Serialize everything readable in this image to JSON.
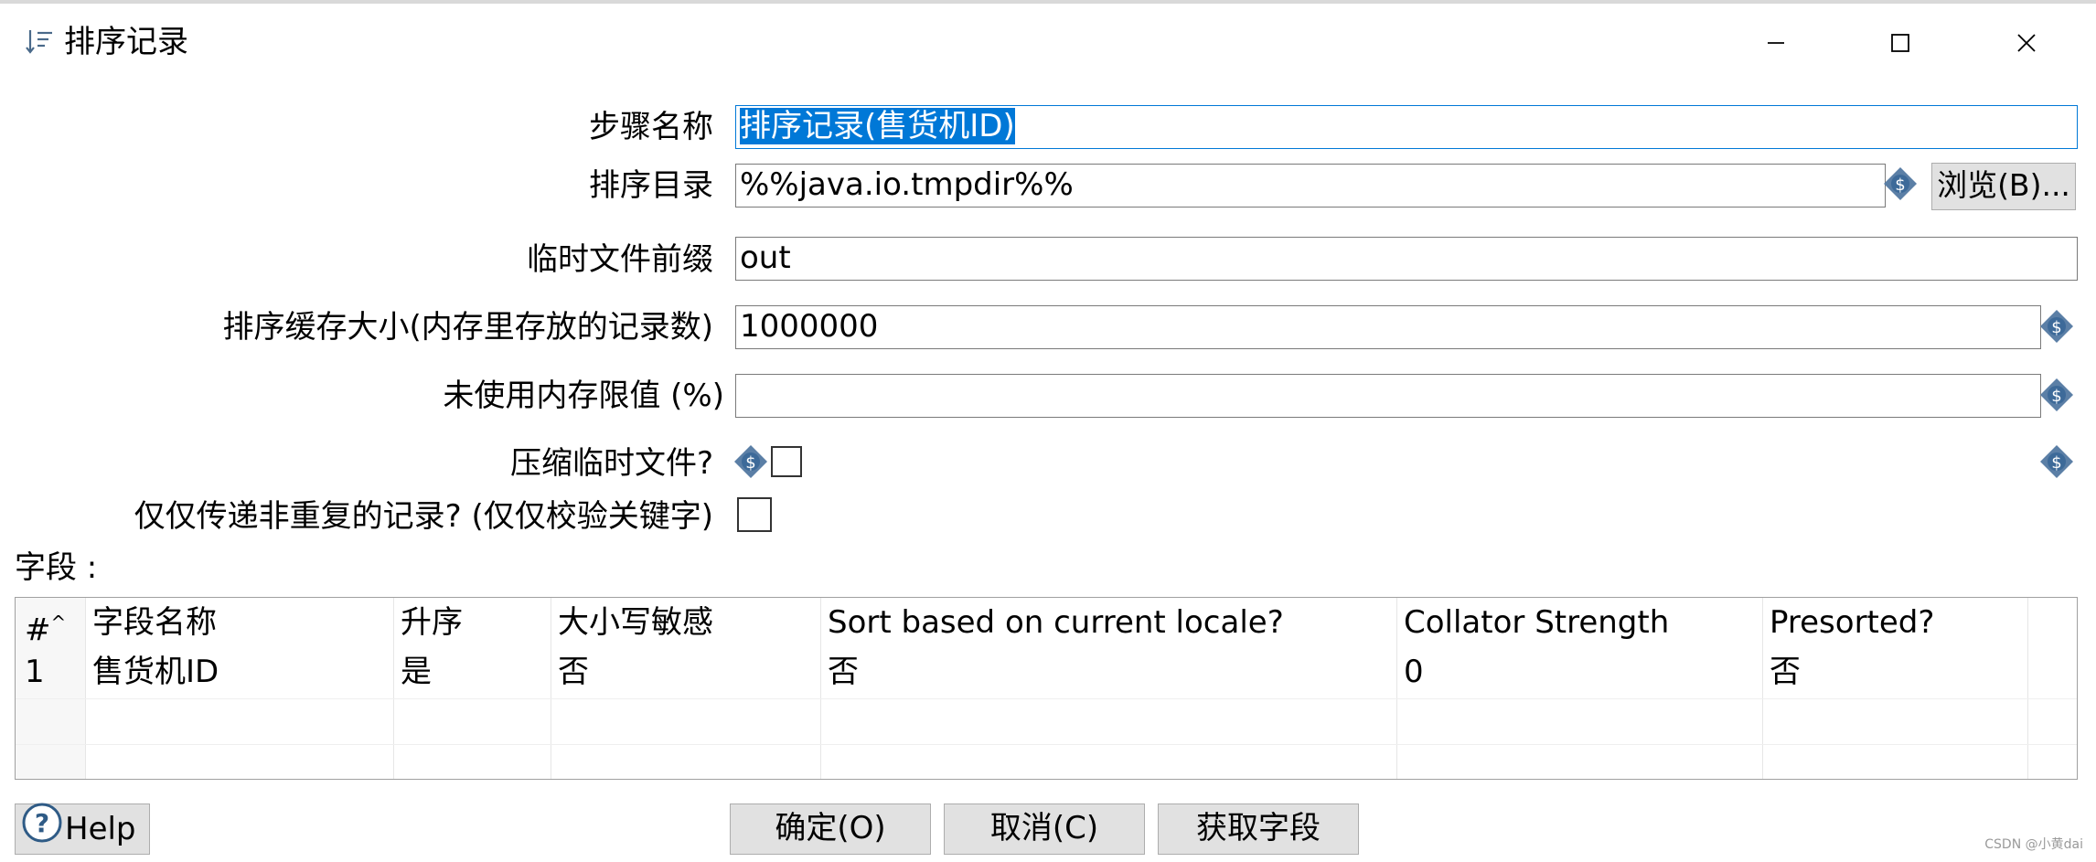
{
  "window": {
    "title": "排序记录",
    "title_icon": "sort-icon",
    "controls": [
      "minimize-icon",
      "maximize-icon",
      "close-icon"
    ]
  },
  "form": {
    "step_name": {
      "label": "步骤名称",
      "value": "排序记录(售货机ID)"
    },
    "sort_dir": {
      "label": "排序目录",
      "value": "%%java.io.tmpdir%%",
      "browse_label": "浏览(B)..."
    },
    "temp_prefix": {
      "label": "临时文件前缀",
      "value": "out"
    },
    "sort_size": {
      "label": "排序缓存大小(内存里存放的记录数)",
      "value": "1000000"
    },
    "free_memory": {
      "label": "未使用内存限值 (%)",
      "value": ""
    },
    "compress": {
      "label": "压缩临时文件?",
      "checked": false
    },
    "unique_rows": {
      "label": "仅仅传递非重复的记录? (仅仅校验关键字)",
      "checked": false
    }
  },
  "fields": {
    "section_label": "字段 :",
    "columns": [
      "#",
      "字段名称",
      "升序",
      "大小写敏感",
      "Sort based on current locale?",
      "Collator Strength",
      "Presorted?"
    ],
    "rows": [
      [
        "1",
        "售货机ID",
        "是",
        "否",
        "否",
        "0",
        "否"
      ]
    ]
  },
  "buttons": {
    "help": "Help",
    "ok": "确定(O)",
    "cancel": "取消(C)",
    "get_fields": "获取字段"
  },
  "colors": {
    "selection": "#0078d7",
    "button_bg": "#e1e1e1",
    "variable_icon": "#5b7fa6"
  },
  "watermark": "CSDN @小黄dai"
}
